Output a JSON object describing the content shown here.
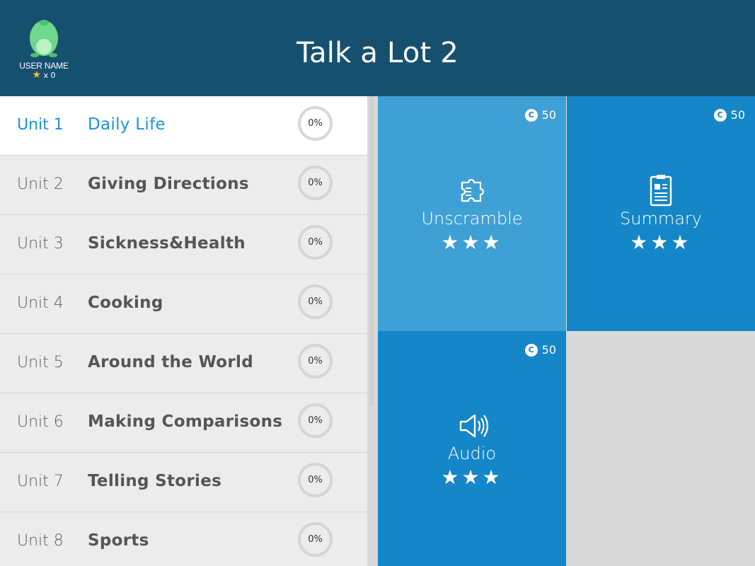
{
  "app": {
    "title": "Talk a Lot 2",
    "user_name": "USER NAME",
    "star_count": "x 0"
  },
  "units": [
    {
      "num": "Unit 1",
      "title": "Daily Life",
      "progress": "0%",
      "active": true
    },
    {
      "num": "Unit 2",
      "title": "Giving Directions",
      "progress": "0%",
      "active": false
    },
    {
      "num": "Unit 3",
      "title": "Sickness&Health",
      "progress": "0%",
      "active": false
    },
    {
      "num": "Unit 4",
      "title": "Cooking",
      "progress": "0%",
      "active": false
    },
    {
      "num": "Unit 5",
      "title": "Around the World",
      "progress": "0%",
      "active": false
    },
    {
      "num": "Unit 6",
      "title": "Making Comparisons",
      "progress": "0%",
      "active": false
    },
    {
      "num": "Unit 7",
      "title": "Telling Stories",
      "progress": "0%",
      "active": false
    },
    {
      "num": "Unit 8",
      "title": "Sports",
      "progress": "0%",
      "active": false
    }
  ],
  "activities": [
    {
      "label": "Unscramble",
      "coins": "50",
      "icon": "puzzle-icon",
      "stars": 3,
      "color": "#3fa0d6"
    },
    {
      "label": "Summary",
      "coins": "50",
      "icon": "document-icon",
      "stars": 3,
      "color": "#1586c8"
    },
    {
      "label": "Audio",
      "coins": "50",
      "icon": "speaker-icon",
      "stars": 3,
      "color": "#1586c8"
    }
  ],
  "colors": {
    "header": "#16506f",
    "accent": "#1b95d6",
    "star": "#f6c025"
  }
}
